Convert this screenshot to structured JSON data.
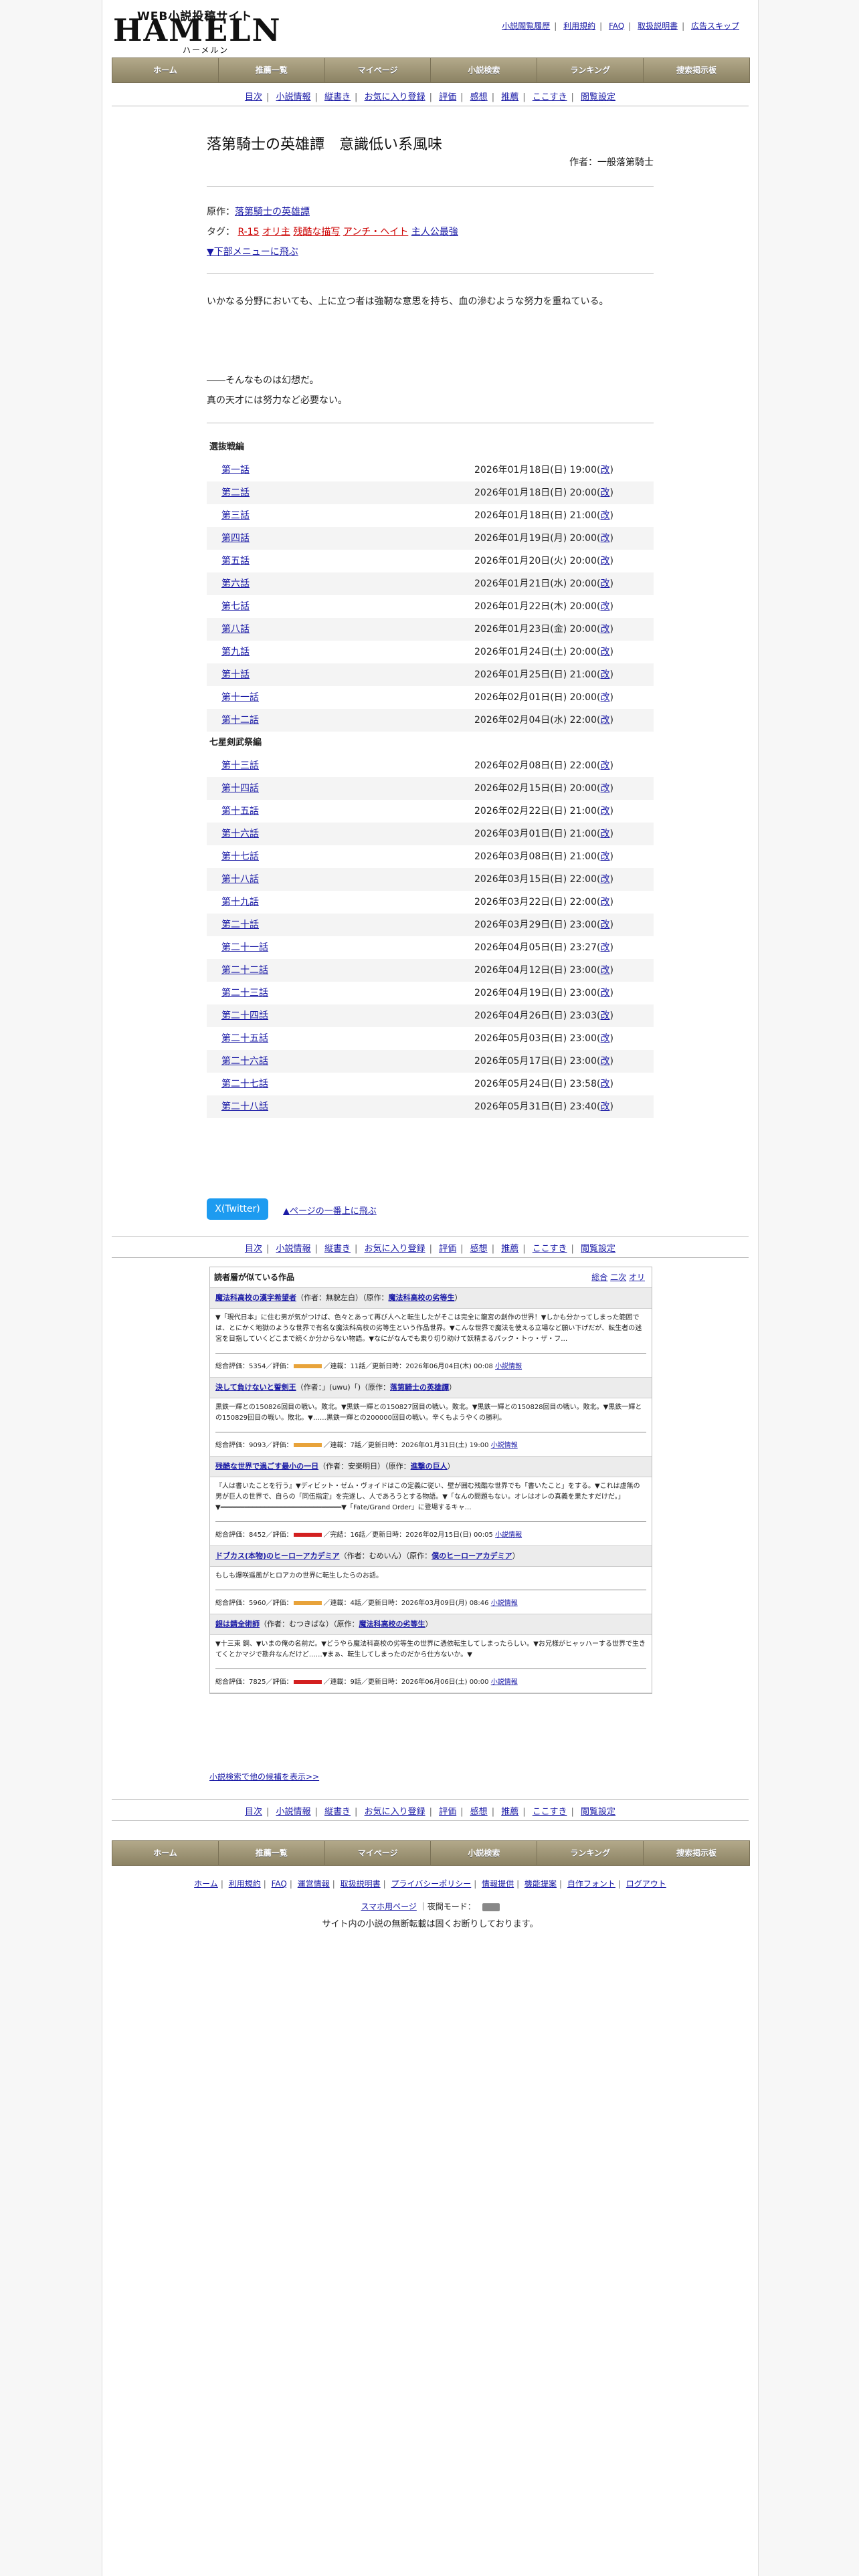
{
  "header": {
    "logo_small": "WEB小説投稿サイト",
    "logo_big": "HAMELN",
    "logo_kana": "ハーメルン",
    "links": [
      "小説閲覧履歴",
      "利用規約",
      "FAQ",
      "取扱説明書",
      "広告スキップ"
    ]
  },
  "gnav": [
    "ホーム",
    "推薦一覧",
    "マイページ",
    "小説検索",
    "ランキング",
    "捜索掲示板"
  ],
  "subnav": [
    "目次",
    "小説情報",
    "縦書き",
    "お気に入り登録",
    "評価",
    "感想",
    "推薦",
    "ここすき",
    "閲覧設定"
  ],
  "novel": {
    "title": "落第騎士の英雄譚　意識低い系風味",
    "author": "作者：一般落第騎士",
    "original_label": "原作：",
    "original": "落第騎士の英雄譚",
    "tags_label": "タグ：",
    "tags_red": [
      "R-15",
      "オリ主",
      "残酷な描写",
      "アンチ・ヘイト"
    ],
    "tags_blue": [
      "主人公最強"
    ],
    "bottom_menu": "▼下部メニューに飛ぶ",
    "preface": "いかなる分野においても、上に立つ者は強靭な意思を持ち、血の滲むような努力を重ねている。",
    "line1": "――そんなものは幻想だ。",
    "line2": "真の天才には努力など必要ない。"
  },
  "toc": {
    "sections": [
      {
        "title": "選抜戦編",
        "episodes": [
          {
            "t": "第一話",
            "d": "2026年01月18日(日) 19:00",
            "k": "改"
          },
          {
            "t": "第二話",
            "d": "2026年01月18日(日) 20:00",
            "k": "改"
          },
          {
            "t": "第三話",
            "d": "2026年01月18日(日) 21:00",
            "k": "改"
          },
          {
            "t": "第四話",
            "d": "2026年01月19日(月) 20:00",
            "k": "改"
          },
          {
            "t": "第五話",
            "d": "2026年01月20日(火) 20:00",
            "k": "改"
          },
          {
            "t": "第六話",
            "d": "2026年01月21日(水) 20:00",
            "k": "改"
          },
          {
            "t": "第七話",
            "d": "2026年01月22日(木) 20:00",
            "k": "改"
          },
          {
            "t": "第八話",
            "d": "2026年01月23日(金) 20:00",
            "k": "改"
          },
          {
            "t": "第九話",
            "d": "2026年01月24日(土) 20:00",
            "k": "改"
          },
          {
            "t": "第十話",
            "d": "2026年01月25日(日) 21:00",
            "k": "改"
          },
          {
            "t": "第十一話",
            "d": "2026年02月01日(日) 20:00",
            "k": "改"
          },
          {
            "t": "第十二話",
            "d": "2026年02月04日(水) 22:00",
            "k": "改"
          }
        ]
      },
      {
        "title": "七星剣武祭編",
        "episodes": [
          {
            "t": "第十三話",
            "d": "2026年02月08日(日) 22:00",
            "k": "改"
          },
          {
            "t": "第十四話",
            "d": "2026年02月15日(日) 20:00",
            "k": "改"
          },
          {
            "t": "第十五話",
            "d": "2026年02月22日(日) 21:00",
            "k": "改"
          },
          {
            "t": "第十六話",
            "d": "2026年03月01日(日) 21:00",
            "k": "改"
          },
          {
            "t": "第十七話",
            "d": "2026年03月08日(日) 21:00",
            "k": "改"
          },
          {
            "t": "第十八話",
            "d": "2026年03月15日(日) 22:00",
            "k": "改"
          },
          {
            "t": "第十九話",
            "d": "2026年03月22日(日) 22:00",
            "k": "改"
          },
          {
            "t": "第二十話",
            "d": "2026年03月29日(日) 23:00",
            "k": "改"
          },
          {
            "t": "第二十一話",
            "d": "2026年04月05日(日) 23:27",
            "k": "改"
          },
          {
            "t": "第二十二話",
            "d": "2026年04月12日(日) 23:00",
            "k": "改"
          },
          {
            "t": "第二十三話",
            "d": "2026年04月19日(日) 23:00",
            "k": "改"
          },
          {
            "t": "第二十四話",
            "d": "2026年04月26日(日) 23:03",
            "k": "改"
          },
          {
            "t": "第二十五話",
            "d": "2026年05月03日(日) 23:00",
            "k": "改"
          },
          {
            "t": "第二十六話",
            "d": "2026年05月17日(日) 23:00",
            "k": "改"
          },
          {
            "t": "第二十七話",
            "d": "2026年05月24日(日) 23:58",
            "k": "改"
          },
          {
            "t": "第二十八話",
            "d": "2026年05月31日(日) 23:40",
            "k": "改"
          }
        ]
      }
    ]
  },
  "share": {
    "twitter": "X(Twitter)",
    "to_top": "▲ページの一番上に飛ぶ"
  },
  "recommend": {
    "heading": "読者層が似ている作品",
    "tabs": [
      "総合",
      "二次",
      "オリ"
    ],
    "items": [
      {
        "title": "魔法科高校の漢字希望者",
        "author": "（作者：無貌左白）（原作：",
        "original": "魔法科高校の劣等生",
        "close": "）",
        "desc": "▼「現代日本」に住む男が気がつけば、色々とあって再び人へと転生したがそこは完全に龍宮の創作の世界！▼しかも分かってしまった範囲では、とにかく地獄のような世界で有名な魔法科高校の劣等生という作品世界。▼こんな世界で魔法を使える立場など願い下げだが、転生者の迷宮を目指していくどこまで続くか分からない物語。▼なにがなんでも乗り切り助けて妖精まるパック・トゥ・ザ・フ…",
        "foot": "総合評価：5354／評価：",
        "color": "#e8a33a",
        "foot2": "／連載：11話／更新日時：2026年06月04日(木) 00:08",
        "info": "小説情報"
      },
      {
        "title": "決して負けないと誓剣王",
        "author": "（作者：」(uwu)「)（原作：",
        "original": "落第騎士の英雄譚",
        "close": "）",
        "desc": "黒鉄一輝との150826回目の戦い。敗北。▼黒鉄一輝との150827回目の戦い。敗北。▼黒鉄一輝との150828回目の戦い。敗北。▼黒鉄一輝との150829回目の戦い。敗北。▼……黒鉄一輝との200000回目の戦い。辛くもようやくの勝利。",
        "foot": "総合評価：9093／評価：",
        "color": "#e8a33a",
        "foot2": "／連載：7話／更新日時：2026年01月31日(土) 19:00",
        "info": "小説情報"
      },
      {
        "title": "残酷な世界で過ごす最小の一日",
        "author": "（作者：安楽明日）（原作：",
        "original": "進撃の巨人",
        "close": "）",
        "desc": "『人は書いたことを行う』▼ディビット・ゼム・ヴォイドはこの定義に従い、壁が囲む残酷な世界でも「書いたこと」をする。▼これは虚無の男が巨人の世界で、自らの「同伍指定」を完遂し、人であろうとする物語。▼「なんの問題もない。オレはオレの真義を果たすだけだ。」▼━━━━━━━━━━━━━━━━━━━━━━━━━━━━━━▼「Fate/Grand Order」に登場するキャ…",
        "foot": "総合評価：8452／評価：",
        "color": "#d32020",
        "foot2": "／完結：16話／更新日時：2026年02月15日(日) 00:05",
        "info": "小説情報"
      },
      {
        "title": "ドブカス(本物)のヒーローアカデミア",
        "author": "（作者：むめいん）（原作：",
        "original": "僕のヒーローアカデミア",
        "close": "）",
        "desc": "もしも爆咲遥風がヒロアカの世界に転生したらのお話。",
        "foot": "総合評価：5960／評価：",
        "color": "#e8a33a",
        "foot2": "／連載：4話／更新日時：2026年03月09日(月) 08:46",
        "info": "小説情報"
      },
      {
        "title": "銀は錆全術師",
        "author": "（作者：むつきばな）（原作：",
        "original": "魔法科高校の劣等生",
        "close": "）",
        "desc": "▼十三束 鋼、▼いまの俺の名前だ。▼どうやら魔法科高校の劣等生の世界に憑依転生してしまったらしい。▼お兄様がヒャッハーする世界で生きてくとかマジで勘弁なんだけど……▼まぁ、転生してしまったのだから仕方ないか。▼",
        "foot": "総合評価：7825／評価：",
        "color": "#d32020",
        "foot2": "／連載：9話／更新日時：2026年06月06日(土) 00:00",
        "info": "小説情報"
      }
    ],
    "more": "小説検索で他の候補を表示>>"
  },
  "footer": {
    "links1": [
      "ホーム",
      "利用規約",
      "FAQ",
      "運営情報",
      "取扱説明書",
      "プライバシーポリシー",
      "情報提供",
      "機能提案",
      "自作フォント",
      "ログアウト"
    ],
    "mode_label": "スマホ用ページ",
    "night_label": "｜夜間モード：",
    "notice": "サイト内の小説の無断転載は固くお断りしております。"
  }
}
